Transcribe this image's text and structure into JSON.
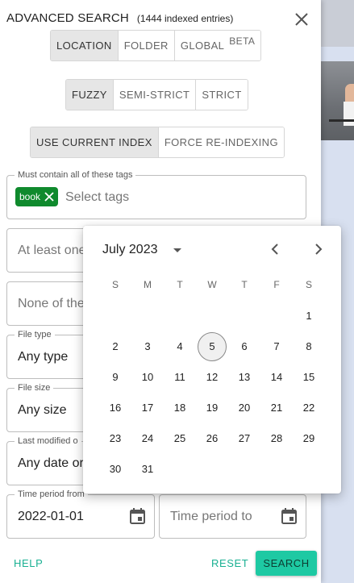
{
  "dialog": {
    "title": "ADVANCED SEARCH",
    "subtitle": "(1444 indexed entries)"
  },
  "scope": {
    "options": [
      "LOCATION",
      "FOLDER",
      "GLOBAL"
    ],
    "beta_label": "BETA",
    "selected": "LOCATION"
  },
  "match": {
    "options": [
      "FUZZY",
      "SEMI-STRICT",
      "STRICT"
    ],
    "selected": "FUZZY"
  },
  "index": {
    "options": [
      "USE CURRENT INDEX",
      "FORCE RE-INDEXING"
    ],
    "selected": "USE CURRENT INDEX"
  },
  "fields": {
    "must_tags": {
      "label": "Must contain all of these tags",
      "chip": "book",
      "placeholder": "Select tags"
    },
    "at_least_one": {
      "placeholder": "At least one"
    },
    "none_of": {
      "placeholder": "None of the"
    },
    "file_type": {
      "label": "File type",
      "value": "Any type"
    },
    "file_size": {
      "label": "File size",
      "value": "Any size"
    },
    "last_modified": {
      "label": "Last modified o",
      "value": "Any date or"
    },
    "time_from": {
      "label": "Time period from",
      "value": "2022-01-01"
    },
    "time_to": {
      "placeholder": "Time period to"
    }
  },
  "footer": {
    "help": "HELP",
    "reset": "RESET",
    "search": "SEARCH"
  },
  "datepicker": {
    "month_label": "July 2023",
    "weekdays": [
      "S",
      "M",
      "T",
      "W",
      "T",
      "F",
      "S"
    ],
    "first_weekday_index": 6,
    "days_in_month": 31,
    "today": 5
  },
  "colors": {
    "accent": "#19b092",
    "search_button": "#1ec9a3",
    "tag_chip": "#0f8a2d"
  },
  "icons": {
    "close": "close-icon",
    "chip_remove": "close-icon",
    "calendar": "calendar-icon",
    "month_dropdown": "caret-down-icon",
    "prev": "chevron-left-icon",
    "next": "chevron-right-icon"
  }
}
